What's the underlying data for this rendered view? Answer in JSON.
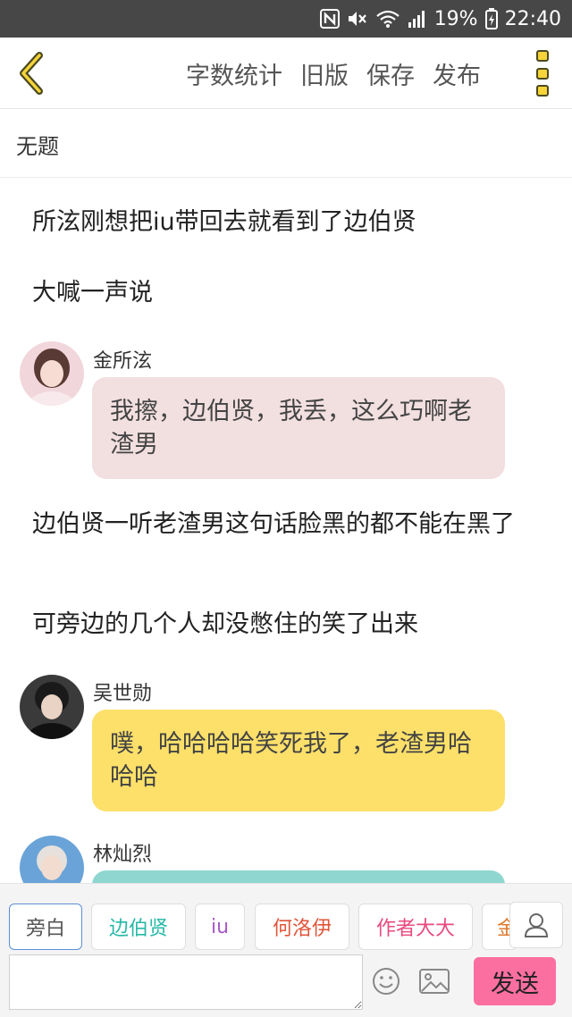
{
  "status_bar": {
    "battery": "19%",
    "time": "22:40",
    "icons": [
      "nfc-icon",
      "mute-icon",
      "wifi-icon",
      "signal-icon",
      "battery-icon"
    ]
  },
  "toolbar": {
    "actions": [
      "字数统计",
      "旧版",
      "保存",
      "发布"
    ],
    "back_icon": "chevron-left-icon",
    "more_icon": "more-vertical-icon",
    "accent": "#f6d43a"
  },
  "story": {
    "title": "无题"
  },
  "messages": [
    {
      "type": "narration",
      "text": "所泫刚想把iu带回去就看到了边伯贤"
    },
    {
      "type": "narration",
      "text": "大喊一声说"
    },
    {
      "type": "dialogue",
      "speaker": "金所泫",
      "text": "我擦，边伯贤，我丢，这么巧啊老渣男",
      "bubble_color": "#f2dfe0"
    },
    {
      "type": "narration",
      "text": "边伯贤一听老渣男这句话脸黑的都不能在黑了"
    },
    {
      "type": "narration",
      "text": "可旁边的几个人却没憋住的笑了出来"
    },
    {
      "type": "dialogue",
      "speaker": "吴世勋",
      "text": "噗，哈哈哈哈笑死我了，老渣男哈哈哈",
      "bubble_color": "#fde06a"
    },
    {
      "type": "dialogue",
      "speaker": "林灿烈",
      "text": "",
      "bubble_color": "#8fd6d0"
    }
  ],
  "characters": [
    {
      "name": "旁白",
      "color": "#555555",
      "selected": true
    },
    {
      "name": "边伯贤",
      "color": "#27b8a7",
      "selected": false
    },
    {
      "name": "iu",
      "color": "#a65ac7",
      "selected": false
    },
    {
      "name": "何洛伊",
      "color": "#e0553a",
      "selected": false
    },
    {
      "name": "作者大大",
      "color": "#e84a7f",
      "selected": false
    },
    {
      "name": "金",
      "color": "#e07a2e",
      "selected": false
    }
  ],
  "input": {
    "placeholder": "",
    "value": "",
    "send_label": "发送",
    "send_color": "#fb6fa0"
  }
}
